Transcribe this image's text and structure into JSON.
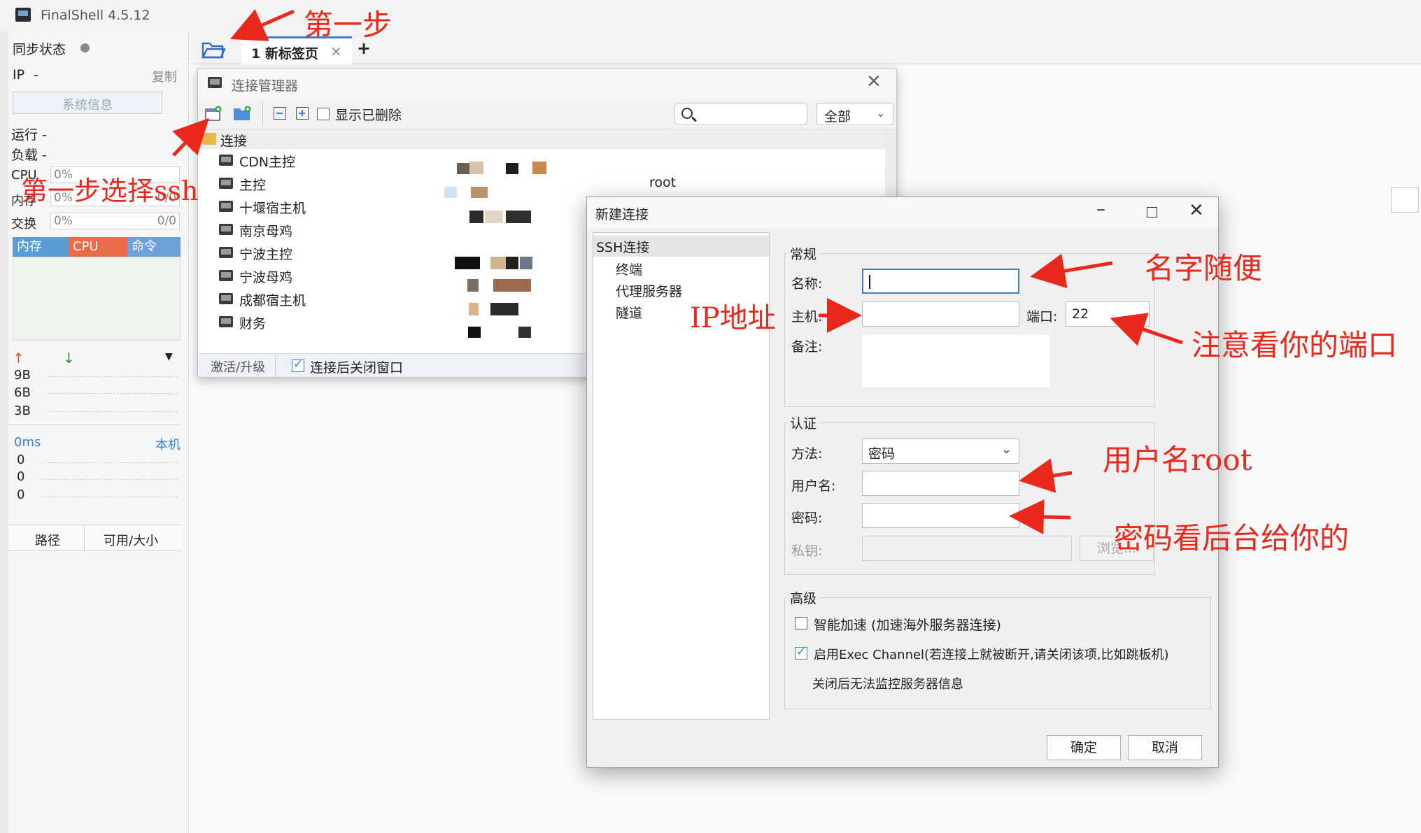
{
  "app": {
    "title": "FinalShell 4.5.12"
  },
  "sidebar": {
    "sync_label": "同步状态",
    "ip_label": "IP",
    "ip_value": "-",
    "copy_label": "复制",
    "sysinfo_button": "系统信息",
    "run_label": "运行 -",
    "load_label": "负载 -",
    "cpu_label": "CPU",
    "cpu_value": "0%",
    "mem_label": "内存",
    "mem_value": "0%",
    "mem_size": "0/0",
    "swap_label": "交换",
    "swap_value": "0%",
    "swap_size": "0/0",
    "monitor_tabs": [
      "内存",
      "CPU",
      "命令"
    ],
    "net_levels": [
      "9B",
      "6B",
      "3B"
    ],
    "ping_label": "0ms",
    "ping_target": "本机",
    "ping_values": [
      "0",
      "0",
      "0"
    ],
    "disk_cols": [
      "路径",
      "可用/大小"
    ]
  },
  "tabs": {
    "active_label": "1 新标签页",
    "close": "×",
    "add": "+"
  },
  "conn_manager": {
    "title": "连接管理器",
    "show_deleted_label": "显示已删除",
    "filter_value": "全部",
    "root_folder": "连接",
    "items": [
      "CDN主控",
      "主控",
      "十堰宿主机",
      "南京母鸡",
      "宁波主控",
      "宁波母鸡",
      "成都宿主机",
      "财务"
    ],
    "user_visible": "root",
    "activate_label": "激活/升级",
    "close_after_connect_label": "连接后关闭窗口"
  },
  "new_conn": {
    "title": "新建连接",
    "nav": [
      "SSH连接",
      "终端",
      "代理服务器",
      "隧道"
    ],
    "general_group": "常规",
    "name_label": "名称:",
    "name_value": "",
    "host_label": "主机:",
    "host_value": "",
    "port_label": "端口:",
    "port_value": "22",
    "note_label": "备注:",
    "auth_group": "认证",
    "method_label": "方法:",
    "method_value": "密码",
    "user_label": "用户名:",
    "password_label": "密码:",
    "key_label": "私钥:",
    "browse_button": "浏览...",
    "advanced_group": "高级",
    "smart_accel_label": "智能加速 (加速海外服务器连接)",
    "exec_channel_label": "启用Exec Channel(若连接上就被断开,请关闭该项,比如跳板机)",
    "exec_channel_note": "关闭后无法监控服务器信息",
    "ok_button": "确定",
    "cancel_button": "取消"
  },
  "annotations": {
    "step1": "第一步",
    "step2": "第一步选择ssh",
    "name_hint": "名字随便",
    "ip_hint": "IP地址",
    "port_hint": "注意看你的端口",
    "user_hint": "用户名root",
    "password_hint": "密码看后台给你的"
  },
  "colors": {
    "accent": "#3b7fd4",
    "annotation": "#e8291c",
    "monitor_tab_bar": "#5b9bd5"
  }
}
